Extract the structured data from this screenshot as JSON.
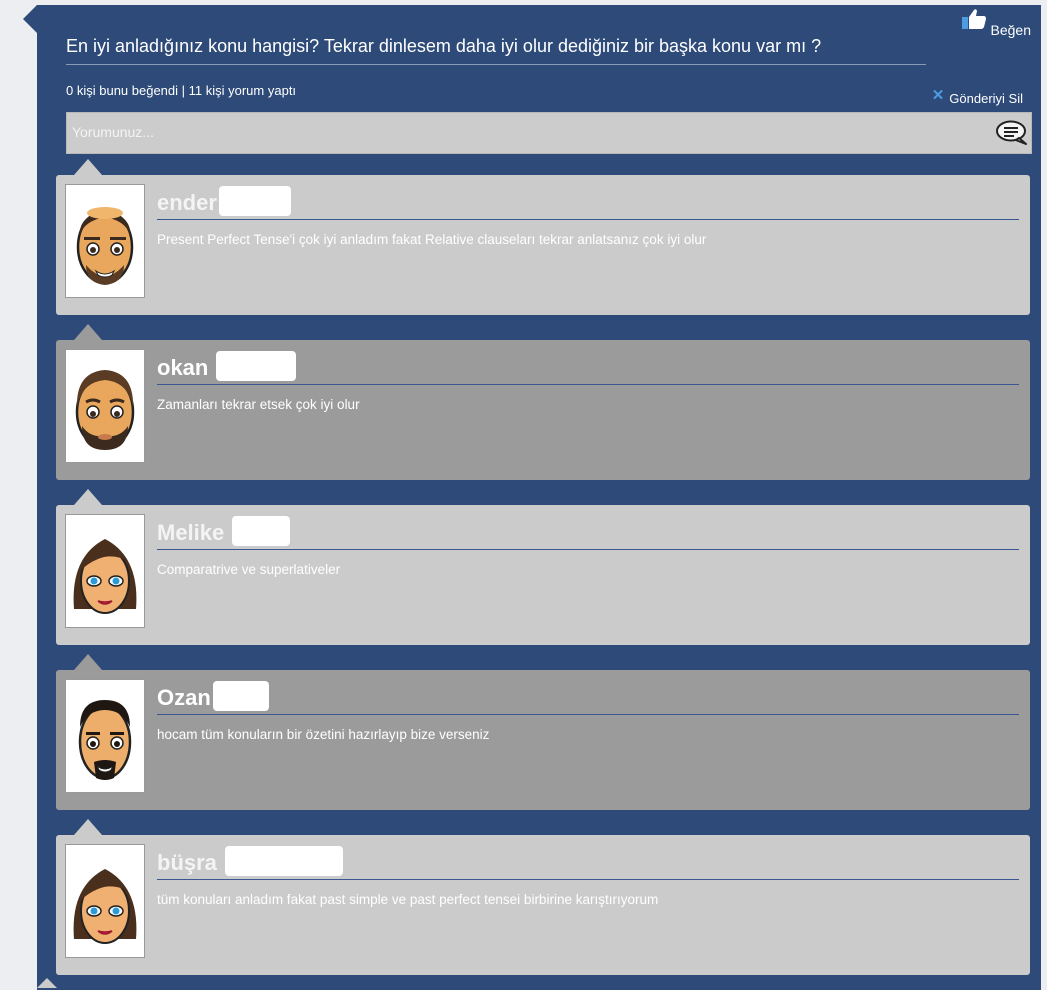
{
  "post": {
    "question": "En iyi anladığınız konu hangisi? Tekrar dinlesem daha iyi olur dediğiniz bir başka konu var mı ?",
    "like_label": "Beğen",
    "stats": "0 kişi bunu beğendi | 11 kişi yorum yaptı",
    "delete_label": "Gönderiyi Sil",
    "comment_placeholder": "Yorumunuz...",
    "comment_value": ""
  },
  "icons": {
    "like": "thumbs-up-icon",
    "delete": "close-icon",
    "send": "speech-bubble-icon"
  },
  "comments": [
    {
      "name": "ender",
      "text": "Present Perfect Tense'i çok iyi anladım fakat Relative clauseları tekrar anlatsanız çok iyi olur",
      "avatar": "bald-man-avatar"
    },
    {
      "name": "okan",
      "text": "Zamanları tekrar etsek çok iyi olur",
      "avatar": "bearded-man-avatar"
    },
    {
      "name": "Melike",
      "text": "Comparatrive ve superlativeler",
      "avatar": "woman-avatar"
    },
    {
      "name": "Ozan",
      "text": "hocam tüm konuların bir özetini hazırlayıp bize verseniz",
      "avatar": "goatee-man-avatar"
    },
    {
      "name": "büşra",
      "text": "tüm konuları anladım fakat past simple ve past perfect tensei birbirine karıştırıyorum",
      "avatar": "woman-avatar"
    }
  ],
  "colors": {
    "post_bg": "#2d4a78",
    "comment_light": "#cbcbcb",
    "comment_dark": "#9b9b9b",
    "accent_blue": "#4d9be0"
  }
}
